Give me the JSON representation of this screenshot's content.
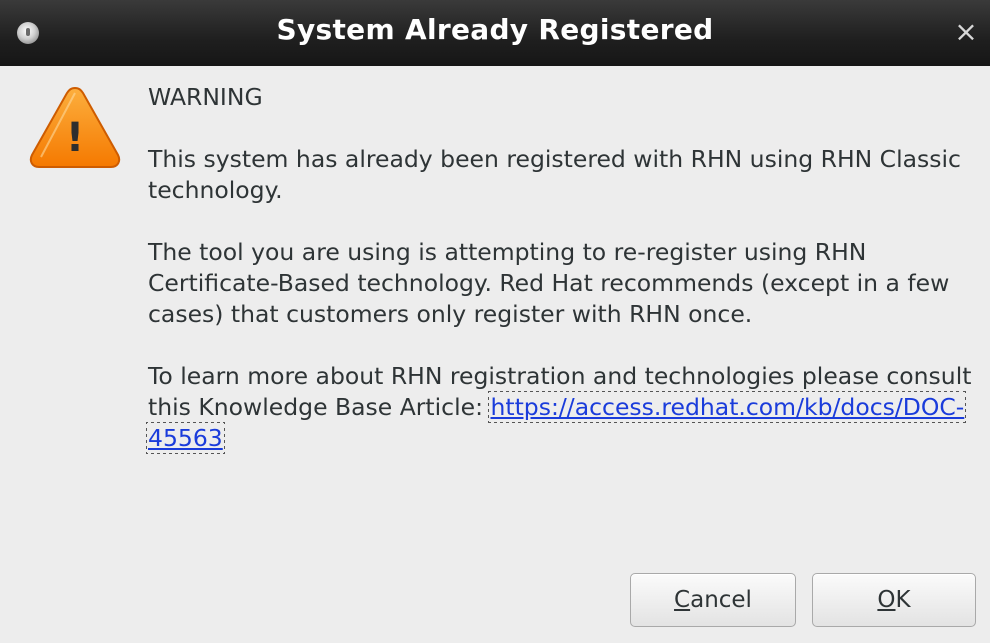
{
  "window": {
    "title": "System Already Registered",
    "close_glyph": "×",
    "menu_icon": "window-menu-icon"
  },
  "icon": {
    "name": "warning-icon",
    "glyph": "!",
    "color": "#f57900"
  },
  "message": {
    "heading": "WARNING",
    "para1": "This system has already been registered with RHN using RHN Classic technology.",
    "para2": "The tool you are using is attempting to re-register using RHN Certificate-Based technology. Red Hat recommends (except in a few cases) that customers only register with RHN once.",
    "para3_prefix": "To learn more about RHN registration and technologies please consult this Knowledge Base Article: ",
    "link_text": "https://access.redhat.com/kb/docs/DOC-45563"
  },
  "buttons": {
    "cancel_mnemonic": "C",
    "cancel_rest": "ancel",
    "ok_mnemonic": "O",
    "ok_rest": "K"
  }
}
